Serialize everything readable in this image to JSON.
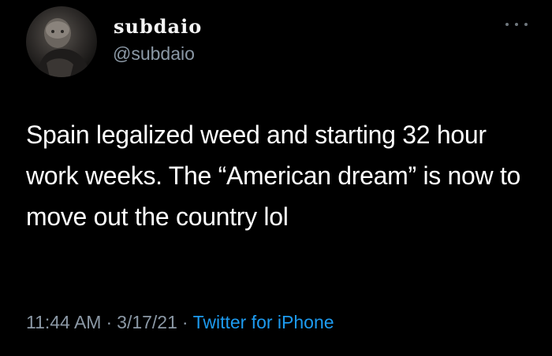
{
  "tweet": {
    "author": {
      "display_name": "ꜱubdaio",
      "handle": "@subdaio",
      "avatar": "avatar-photo"
    },
    "more_icon": "more-horizontal-icon",
    "text": "Spain legalized weed and starting 32 hour work weeks. The “American dream” is now to move out the country lol",
    "time": "11:44 AM",
    "separator": "·",
    "date": "3/17/21",
    "source": "Twitter for iPhone"
  },
  "colors": {
    "background": "#000000",
    "primary_text": "#ffffff",
    "secondary_text": "#8b98a5",
    "link": "#1d9bf0"
  }
}
